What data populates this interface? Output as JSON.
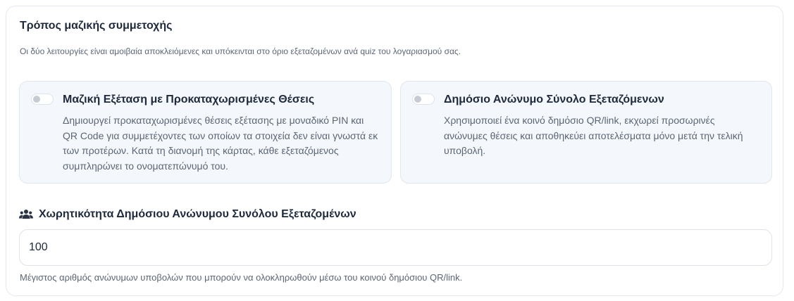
{
  "section": {
    "title": "Τρόπος μαζικής συμμετοχής",
    "description": "Οι δύο λειτουργίες είναι αμοιβαία αποκλειόμενες και υπόκεινται στο όριο εξεταζομένων ανά quiz του λογαριασμού σας."
  },
  "options": [
    {
      "title": "Μαζική Εξέταση με Προκαταχωρισμένες Θέσεις",
      "description": "Δημιουργεί προκαταχωρισμένες θέσεις εξέτασης με μοναδικό PIN και QR Code για συμμετέχοντες των οποίων τα στοιχεία δεν είναι γνωστά εκ των προτέρων. Κατά τη διανομή της κάρτας, κάθε εξεταζόμενος συμπληρώνει το ονοματεπώνυμό του.",
      "enabled": false
    },
    {
      "title": "Δημόσιο Ανώνυμο Σύνολο Εξεταζόμενων",
      "description": "Χρησιμοποιεί ένα κοινό δημόσιο QR/link, εκχωρεί προσωρινές ανώνυμες θέσεις και αποθηκεύει αποτελέσματα μόνο μετά την τελική υποβολή.",
      "enabled": false
    }
  ],
  "capacity": {
    "icon": "users-icon",
    "label": "Χωρητικότητα Δημόσιου Ανώνυμου Συνόλου Εξεταζομένων",
    "value": "100",
    "help": "Μέγιστος αριθμός ανώνυμων υποβολών που μπορούν να ολοκληρωθούν μέσω του κοινού δημόσιου QR/link."
  },
  "colors": {
    "card_background": "#f4f7fb",
    "border": "#e3e8ef",
    "heading_text": "#1e2a3b",
    "muted_text": "#5b6675",
    "toggle_off": "#c6ccd4"
  }
}
